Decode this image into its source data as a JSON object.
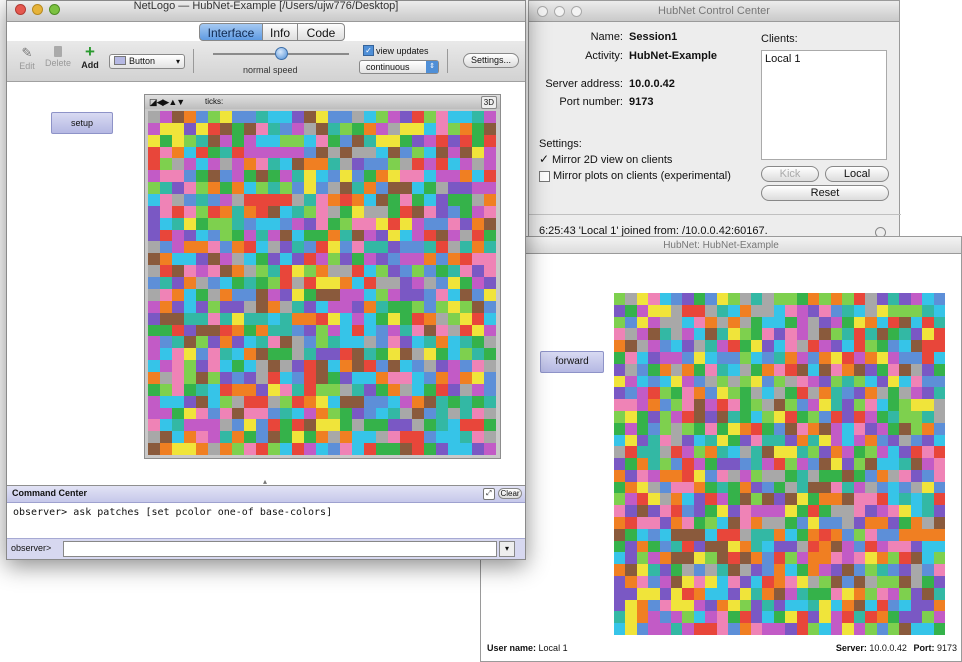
{
  "netlogo": {
    "title": "NetLogo — HubNet-Example [/Users/ujw776/Desktop]",
    "tabs": [
      "Interface",
      "Info",
      "Code"
    ],
    "toolbar": {
      "edit": "Edit",
      "delete": "Delete",
      "add": "Add",
      "widget_type": "Button",
      "speed_label": "normal speed",
      "view_updates": "view updates",
      "update_mode": "continuous",
      "settings": "Settings..."
    },
    "setup_button": "setup",
    "view": {
      "ticks_label": "ticks:",
      "threed": "3D"
    },
    "command_center": {
      "title": "Command Center",
      "clear": "Clear",
      "history": "observer> ask patches [set pcolor one-of base-colors]",
      "prompt": "observer>"
    }
  },
  "control_center": {
    "title": "HubNet Control Center",
    "name_label": "Name:",
    "name_value": "Session1",
    "activity_label": "Activity:",
    "activity_value": "HubNet-Example",
    "server_label": "Server address:",
    "server_value": "10.0.0.42",
    "port_label": "Port number:",
    "port_value": "9173",
    "clients_label": "Clients:",
    "clients": [
      "Local 1"
    ],
    "settings_label": "Settings:",
    "mirror_2d": "Mirror 2D view on clients",
    "mirror_2d_checked": true,
    "mirror_plots": "Mirror plots on clients (experimental)",
    "mirror_plots_checked": false,
    "kick": "Kick",
    "local": "Local",
    "reset": "Reset",
    "log": "6:25:43  'Local 1' joined from: /10.0.0.42:60167."
  },
  "client": {
    "title": "HubNet: HubNet-Example",
    "forward_button": "forward",
    "user_label": "User name:",
    "user_value": "Local 1",
    "server_label": "Server:",
    "server_value": "10.0.0.42",
    "port_label": "Port:",
    "port_value": "9173"
  },
  "patch_colors": [
    "#a8a8a8",
    "#e8463a",
    "#f07f22",
    "#8a5a3c",
    "#f0e43a",
    "#35b24a",
    "#7ed04e",
    "#33b8a4",
    "#36c4e8",
    "#5d8fd8",
    "#7a58c4",
    "#c25bc6",
    "#ef83b6"
  ]
}
